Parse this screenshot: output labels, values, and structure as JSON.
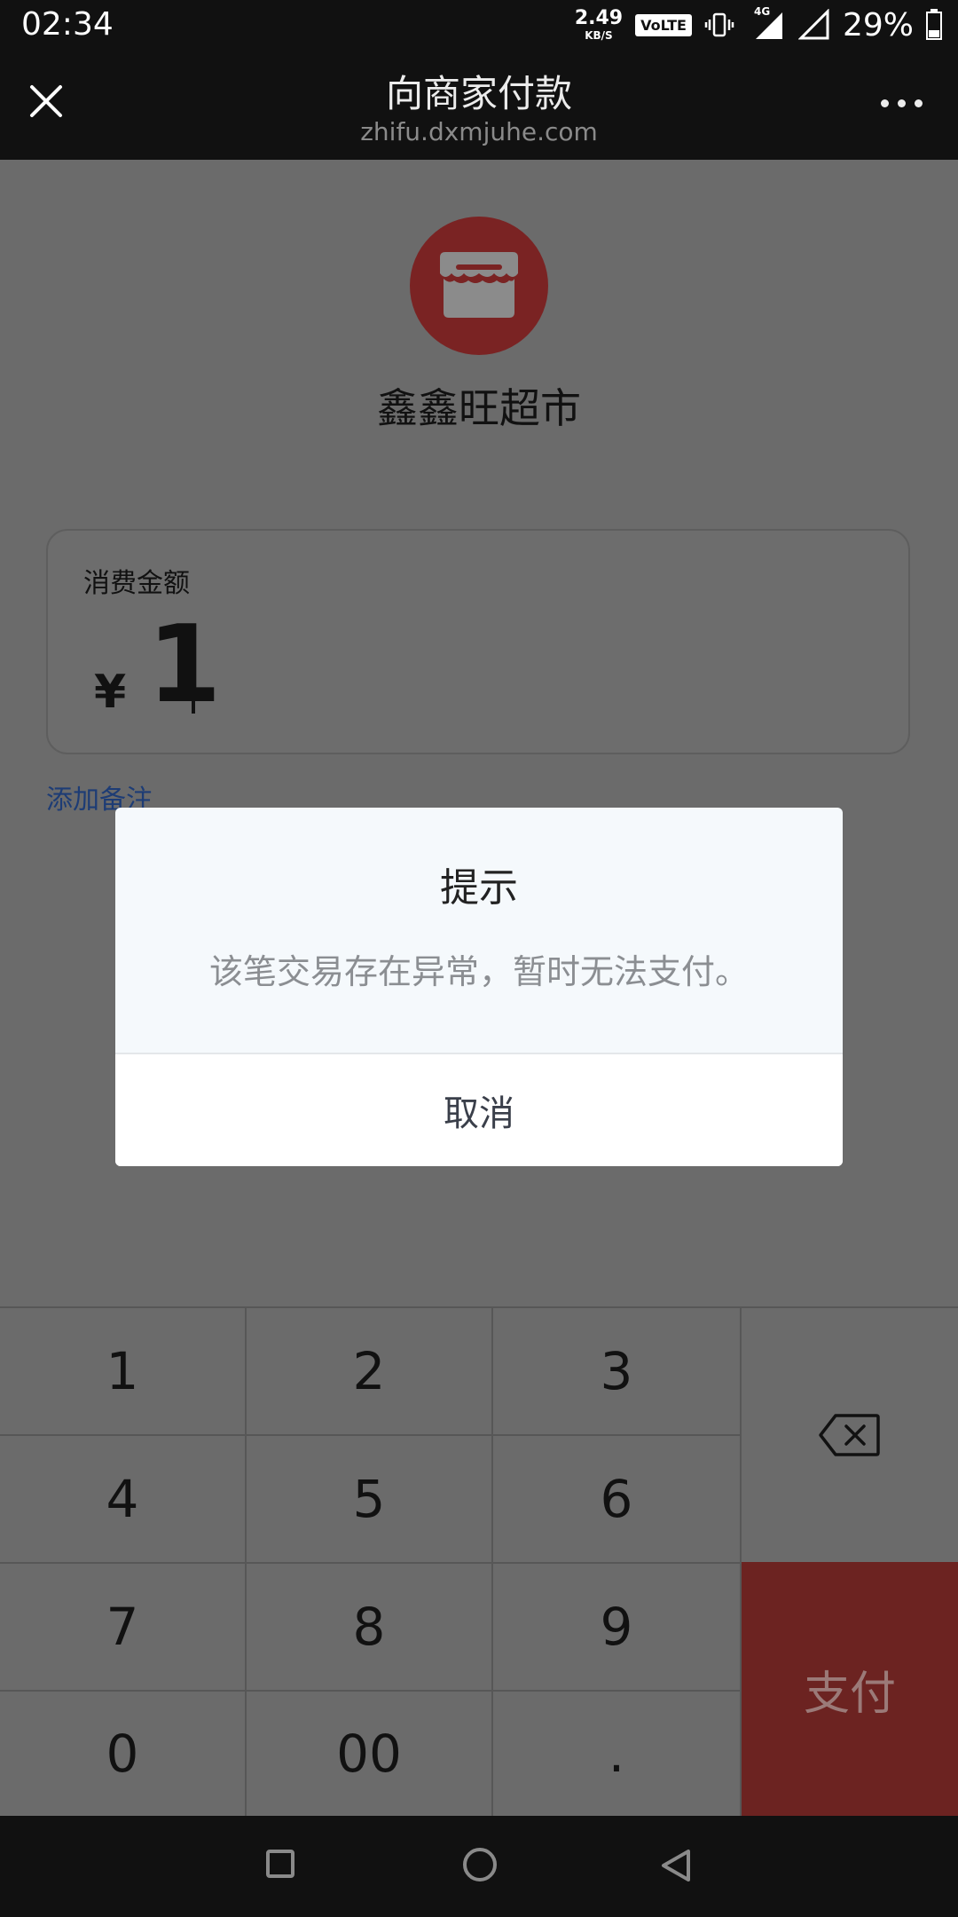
{
  "status_bar": {
    "time": "02:34",
    "net_speed_value": "2.49",
    "net_speed_unit": "KB/S",
    "volte": "V⛄LTE",
    "network_type": "4G",
    "battery_percent": "29%"
  },
  "header": {
    "title": "向商家付款",
    "subtitle": "zhifu.dxmjuhe.com",
    "close_icon": "close-icon",
    "more_icon": "more-icon"
  },
  "merchant": {
    "name": "鑫鑫旺超市",
    "logo_icon": "store-icon",
    "logo_color": "#7a2323"
  },
  "amount": {
    "label": "消费金额",
    "currency": "¥",
    "value": "1"
  },
  "add_note": "添加备注",
  "keypad": {
    "keys": [
      "1",
      "2",
      "3",
      "4",
      "5",
      "6",
      "7",
      "8",
      "9",
      "0",
      "00",
      "."
    ],
    "backspace_icon": "backspace-icon",
    "pay_label": "支付",
    "pay_color": "#6c2321"
  },
  "dialog": {
    "title": "提示",
    "message": "该笔交易存在异常，暂时无法支付。",
    "cancel_label": "取消"
  },
  "nav_bar": {
    "icons": [
      "recent-apps-icon",
      "home-icon",
      "back-icon"
    ]
  }
}
